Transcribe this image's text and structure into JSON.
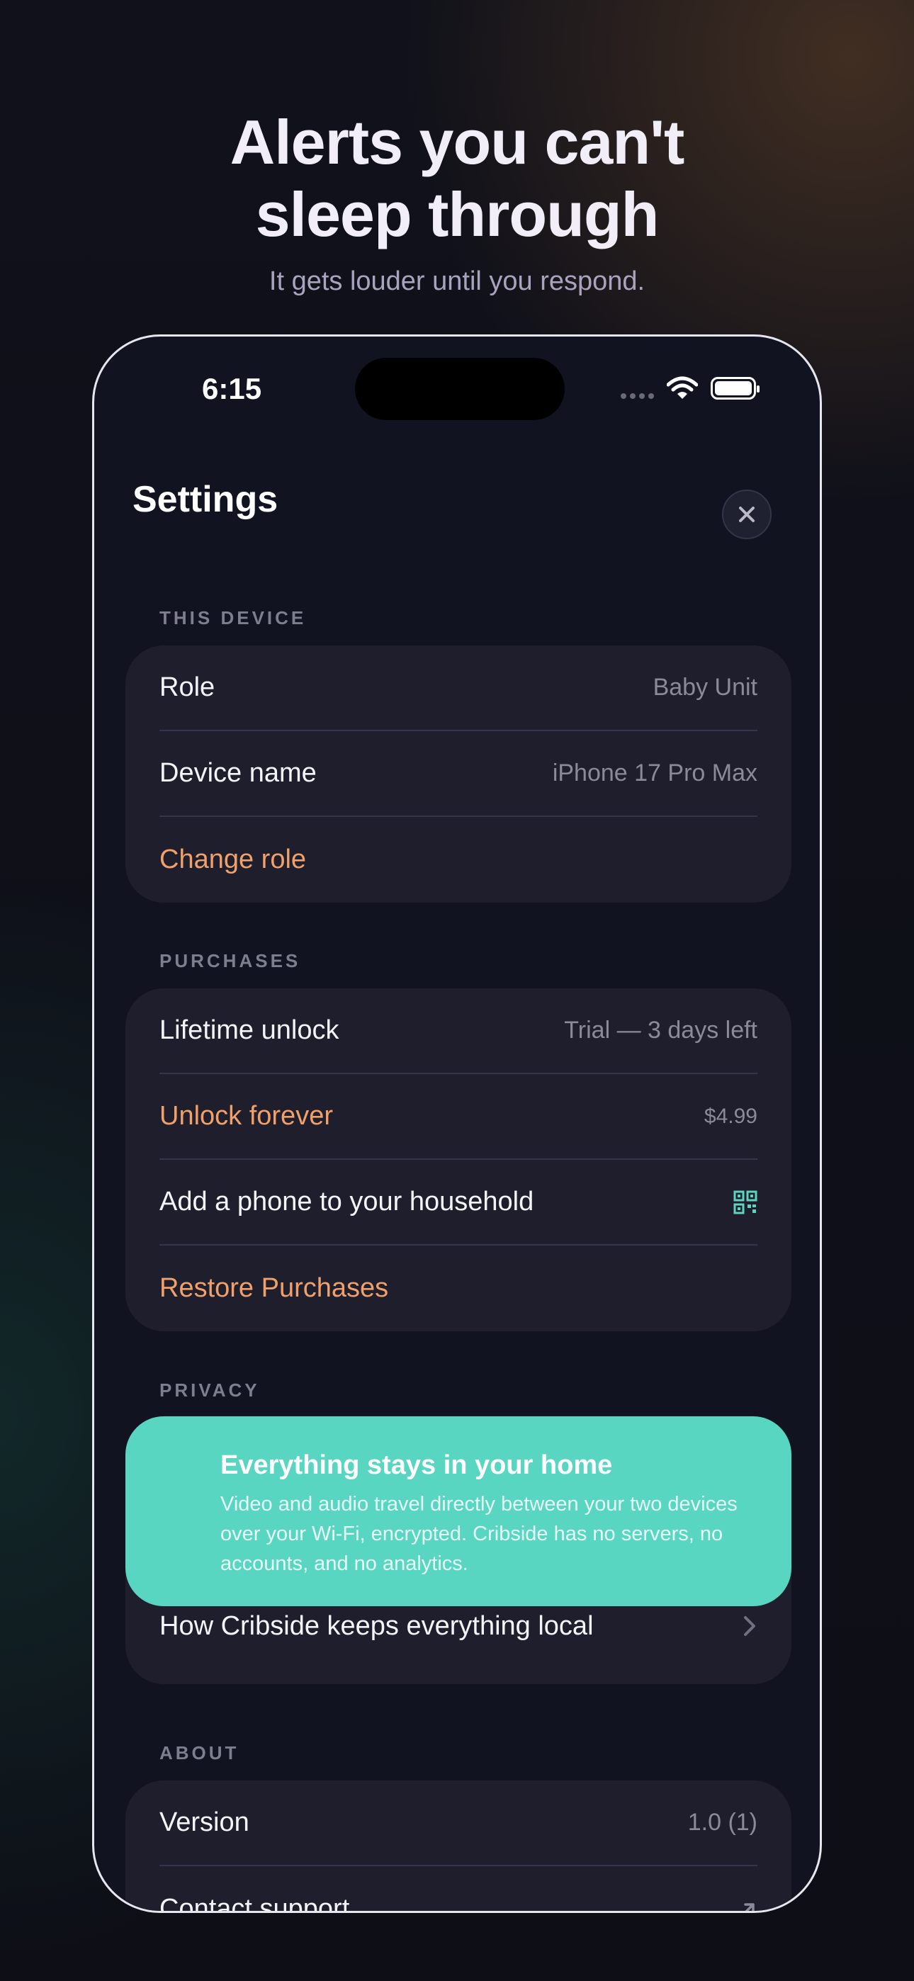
{
  "promo": {
    "headline_line1": "Alerts you can't",
    "headline_line2": "sleep through",
    "subheadline": "It gets louder until you respond."
  },
  "status_bar": {
    "time": "6:15",
    "icons": [
      "cellular-signal-icon",
      "wifi-icon",
      "battery-icon"
    ]
  },
  "nav": {
    "title": "Settings",
    "close_icon": "close-icon"
  },
  "sections": {
    "this_device": {
      "label": "THIS DEVICE",
      "role_label": "Role",
      "role_value": "Baby Unit",
      "device_name_label": "Device name",
      "device_name_value": "iPhone 17 Pro Max",
      "change_role_label": "Change role"
    },
    "purchases": {
      "label": "PURCHASES",
      "lifetime_label": "Lifetime unlock",
      "lifetime_value": "Trial — 3 days left",
      "unlock_label": "Unlock forever",
      "unlock_price": "$4.99",
      "household_label": "Add a phone to your household",
      "household_icon": "qr-code-icon",
      "restore_label": "Restore Purchases"
    },
    "privacy": {
      "label": "PRIVACY",
      "card_title": "Everything stays in your home",
      "card_body": "Video and audio travel directly between your two devices over your Wi-Fi, encrypted. Cribside has no servers, no accounts, and no analytics.",
      "local_label": "How Cribside keeps everything local",
      "local_icon": "chevron-right-icon"
    },
    "about": {
      "label": "ABOUT",
      "version_label": "Version",
      "version_value": "1.0 (1)",
      "support_label": "Contact support",
      "support_icon": "external-link-icon"
    }
  },
  "colors": {
    "accent_orange": "#f0a06a",
    "privacy_teal": "#58d6c1",
    "qr_teal": "#5fd3c0",
    "card_bg": "#1e1e2c",
    "screen_bg": "#121320"
  }
}
